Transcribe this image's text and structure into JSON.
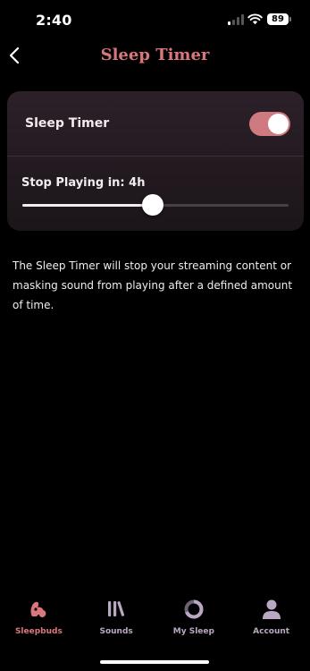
{
  "status_bar": {
    "time": "2:40",
    "battery": "89",
    "signal_bars_on": 1
  },
  "header": {
    "title": "Sleep Timer",
    "back_icon": "chevron-left-icon"
  },
  "settings": {
    "toggle_label": "Sleep Timer",
    "toggle_on": true,
    "slider_label": "Stop Playing in: 4h",
    "slider_fraction": 0.49
  },
  "description": "The Sleep Timer will stop your streaming content or masking sound from playing after a defined amount of time.",
  "tabs": [
    {
      "label": "Sleepbuds",
      "icon": "sleepbuds-icon",
      "active": true
    },
    {
      "label": "Sounds",
      "icon": "library-icon",
      "active": false
    },
    {
      "label": "My Sleep",
      "icon": "sleep-ring-icon",
      "active": false
    },
    {
      "label": "Account",
      "icon": "person-icon",
      "active": false
    }
  ],
  "colors": {
    "accent": "#d9777d",
    "tab_inactive": "#b8a8c2",
    "background": "#000000",
    "card": "#241b21"
  }
}
